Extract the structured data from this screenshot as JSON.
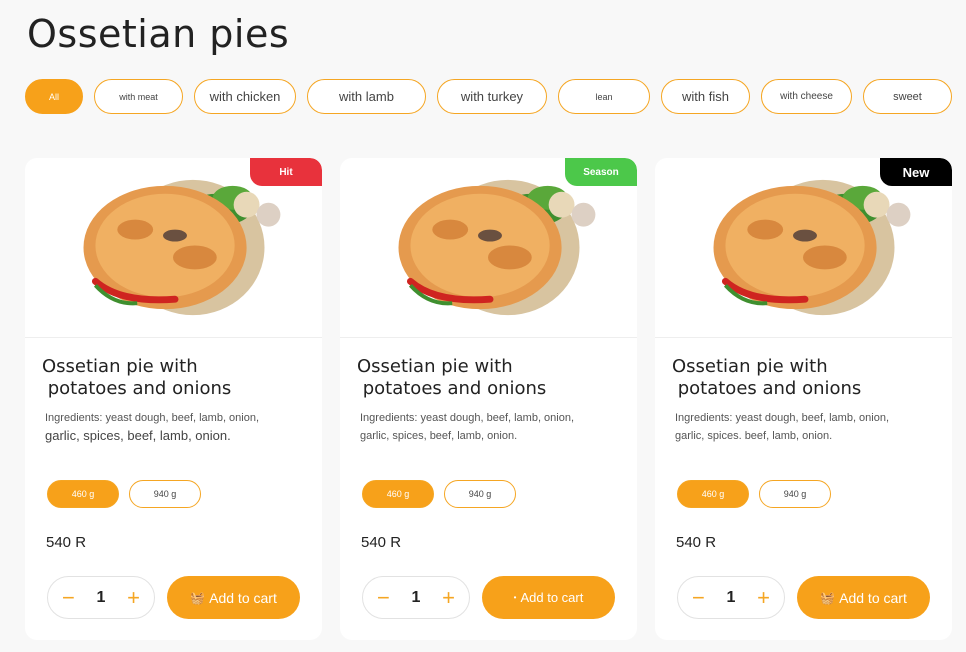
{
  "page": {
    "title": "Ossetian pies"
  },
  "filters": [
    {
      "label": "All",
      "active": true
    },
    {
      "label": "with meat"
    },
    {
      "label": "with chicken"
    },
    {
      "label": "with lamb"
    },
    {
      "label": "with turkey"
    },
    {
      "label": "lean"
    },
    {
      "label": "with fish"
    },
    {
      "label": "with cheese"
    },
    {
      "label": "sweet"
    }
  ],
  "cards": [
    {
      "badge": "Hit",
      "badge_color": "#e8323c",
      "name_line1": "Ossetian pie with",
      "name_line2": " potatoes and onions",
      "ingredients_line1": "Ingredients: yeast dough, beef, lamb, onion,",
      "ingredients_line2": "garlic, spices, beef, lamb, onion.",
      "weight1": "460 g",
      "weight2": "940 g",
      "price": "540 R",
      "qty": "1",
      "minus": "−",
      "plus": "+",
      "cart_label": "Add to cart"
    },
    {
      "badge": "Season",
      "badge_color": "#4cc84a",
      "name_line1": "Ossetian pie with",
      "name_line2": " potatoes and onions",
      "ingredients_line1": "Ingredients: yeast dough, beef, lamb, onion,",
      "ingredients_line2": "garlic, spices, beef, lamb, onion.",
      "weight1": "460 g",
      "weight2": "940 g",
      "price": "540 R",
      "qty": "1",
      "minus": "−",
      "plus": "+",
      "cart_label": "Add to cart"
    },
    {
      "badge": "New",
      "badge_color": "#000000",
      "name_line1": "Ossetian pie with",
      "name_line2": " potatoes and onions",
      "ingredients_line1": "Ingredients: yeast dough, beef, lamb, onion,",
      "ingredients_line2": "garlic, spices. beef, lamb, onion.",
      "weight1": "460 g",
      "weight2": "940 g",
      "price": "540 R",
      "qty": "1",
      "minus": "−",
      "plus": "+",
      "cart_label": "Add to cart"
    }
  ],
  "colors": {
    "accent": "#f7a11a"
  },
  "icons": {
    "basket": "basket-icon",
    "pie": "pie-photo"
  }
}
